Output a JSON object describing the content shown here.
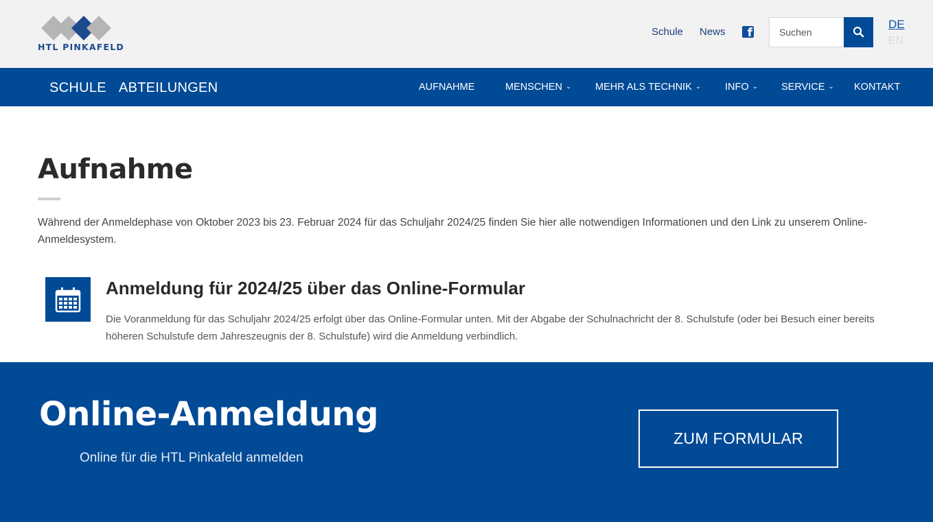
{
  "header": {
    "logo_text": "HTL PINKAFELD",
    "links": [
      "Schule",
      "News"
    ],
    "social_icon": "facebook-icon",
    "search": {
      "placeholder": "Suchen",
      "icon": "search-icon"
    },
    "languages": {
      "active": "DE",
      "inactive": "EN"
    }
  },
  "nav": {
    "main": [
      "SCHULE",
      "ABTEILUNGEN"
    ],
    "items": [
      {
        "label": "AUFNAHME",
        "dropdown": false
      },
      {
        "label": "MENSCHEN",
        "dropdown": true
      },
      {
        "label": "MEHR ALS TECHNIK",
        "dropdown": true
      },
      {
        "label": "INFO",
        "dropdown": true
      },
      {
        "label": "SERVICE",
        "dropdown": true
      },
      {
        "label": "KONTAKT",
        "dropdown": false
      }
    ]
  },
  "content": {
    "title": "Aufnahme",
    "intro": "Während der Anmeldephase von Oktober 2023 bis 23. Februar 2024 für das Schuljahr 2024/25 finden Sie hier alle notwendigen Informationen und den Link zu un­serem Online-Anmeldesystem.",
    "info_icon": "calendar-icon",
    "info_heading": "Anmeldung für 2024/25 über das Online-Formular",
    "info_text": "Die Voranmeldung für das Schuljahr 2024/25 erfolgt über das Online-Formular unten. Mit der Abgabe der Schulnachricht der 8. Schulstufe (oder bei Besuch einer bereits höheren Schulstufe dem Jahreszeugnis der 8. Schulstufe) wird die Anmeldung verbindlich."
  },
  "banner": {
    "title": "Online-Anmeldung",
    "subtitle": "Online für die HTL Pinkafeld anmelden",
    "button": "ZUM FORMULAR"
  },
  "colors": {
    "primary": "#004a96",
    "header_bg": "#f2f2f2",
    "logo_diamond_gray": "#b5b5b5",
    "logo_diamond_blue": "#1c4a8e"
  }
}
